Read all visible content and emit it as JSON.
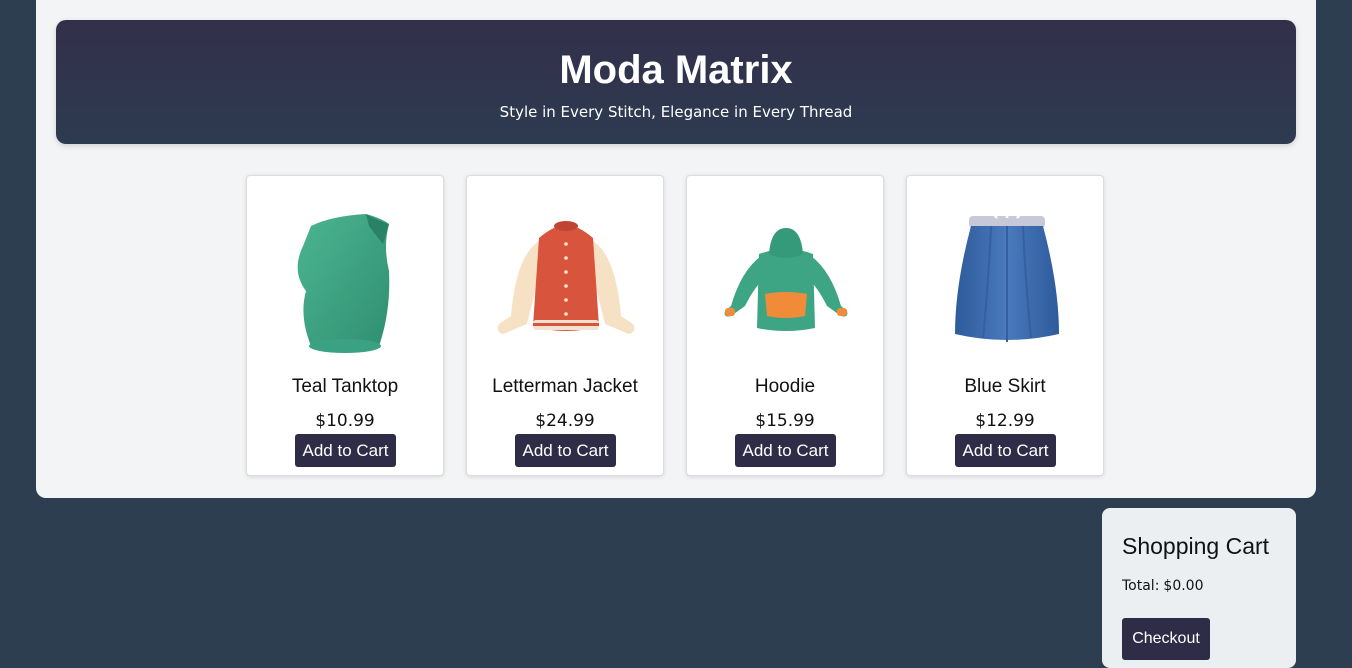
{
  "header": {
    "title": "Moda Matrix",
    "tagline": "Style in Every Stitch, Elegance in Every Thread"
  },
  "products": [
    {
      "name": "Teal Tanktop",
      "price": "$10.99",
      "button": "Add to Cart",
      "icon": "tanktop-image"
    },
    {
      "name": "Letterman Jacket",
      "price": "$24.99",
      "button": "Add to Cart",
      "icon": "jacket-image"
    },
    {
      "name": "Hoodie",
      "price": "$15.99",
      "button": "Add to Cart",
      "icon": "hoodie-image"
    },
    {
      "name": "Blue Skirt",
      "price": "$12.99",
      "button": "Add to Cart",
      "icon": "skirt-image"
    }
  ],
  "cart": {
    "title": "Shopping Cart",
    "total_label": "Total:",
    "total_value": "$0.00",
    "checkout_label": "Checkout"
  },
  "colors": {
    "background": "#2c3e50",
    "panel": "#f3f4f6",
    "header": "#332f4a",
    "button": "#2f2c47"
  }
}
